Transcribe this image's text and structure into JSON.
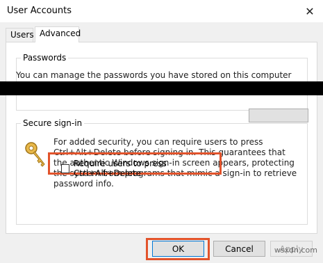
{
  "window": {
    "title": "User Accounts",
    "close_icon": "close-icon"
  },
  "tabs": [
    {
      "label": "Users",
      "selected": false
    },
    {
      "label": "Advanced",
      "selected": true
    }
  ],
  "passwords": {
    "group_title": "Passwords",
    "description": "You can manage the passwords you have stored on this computer"
  },
  "secure_signin": {
    "group_title": "Secure sign-in",
    "icon": "key-icon",
    "description": "For added security, you can require users to press Ctrl+Alt+Delete before signing in. This guarantees that the authentic Windows sign-in screen appears, protecting the system from programs that mimic a sign-in to retrieve password info.",
    "checkbox_label": "Require users to press Ctrl+Alt+Delete",
    "checkbox_checked": false
  },
  "buttons": {
    "ok": "OK",
    "cancel": "Cancel",
    "apply": "Apply"
  },
  "highlight_color": "#e2532b",
  "watermark": "wsxdn.com"
}
